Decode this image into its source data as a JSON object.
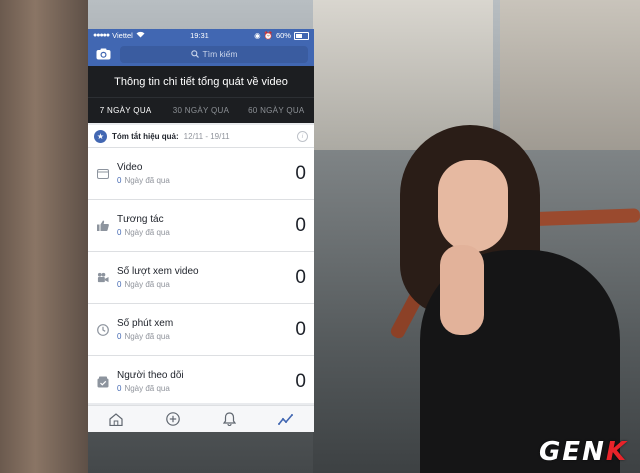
{
  "status_bar": {
    "carrier": "Viettel",
    "time": "19:31",
    "battery": "60%"
  },
  "header": {
    "search_placeholder": "Tìm kiếm"
  },
  "page_title": "Thông tin chi tiết tổng quát về video",
  "tabs": [
    {
      "label": "7 NGÀY QUA",
      "active": true
    },
    {
      "label": "30 NGÀY QUA",
      "active": false
    },
    {
      "label": "60 NGÀY QUA",
      "active": false
    }
  ],
  "summary": {
    "label": "Tóm tắt hiệu quả:",
    "dates": "12/11 - 19/11"
  },
  "metrics": [
    {
      "title": "Video",
      "sub_num": "0",
      "sub_text": "Ngày đã qua",
      "value": "0",
      "icon": "video-icon"
    },
    {
      "title": "Tương tác",
      "sub_num": "0",
      "sub_text": "Ngày đã qua",
      "value": "0",
      "icon": "thumbs-up-icon"
    },
    {
      "title": "Số lượt xem video",
      "sub_num": "0",
      "sub_text": "Ngày đã qua",
      "value": "0",
      "icon": "camera-icon"
    },
    {
      "title": "Số phút xem",
      "sub_num": "0",
      "sub_text": "Ngày đã qua",
      "value": "0",
      "icon": "clock-icon"
    },
    {
      "title": "Người theo dõi",
      "sub_num": "0",
      "sub_text": "Ngày đã qua",
      "value": "0",
      "icon": "follower-icon"
    }
  ],
  "colors": {
    "facebook_blue": "#4167b2",
    "dark_bar": "#1c1e21"
  },
  "watermark": {
    "prefix": "GEN",
    "accent": "K"
  }
}
